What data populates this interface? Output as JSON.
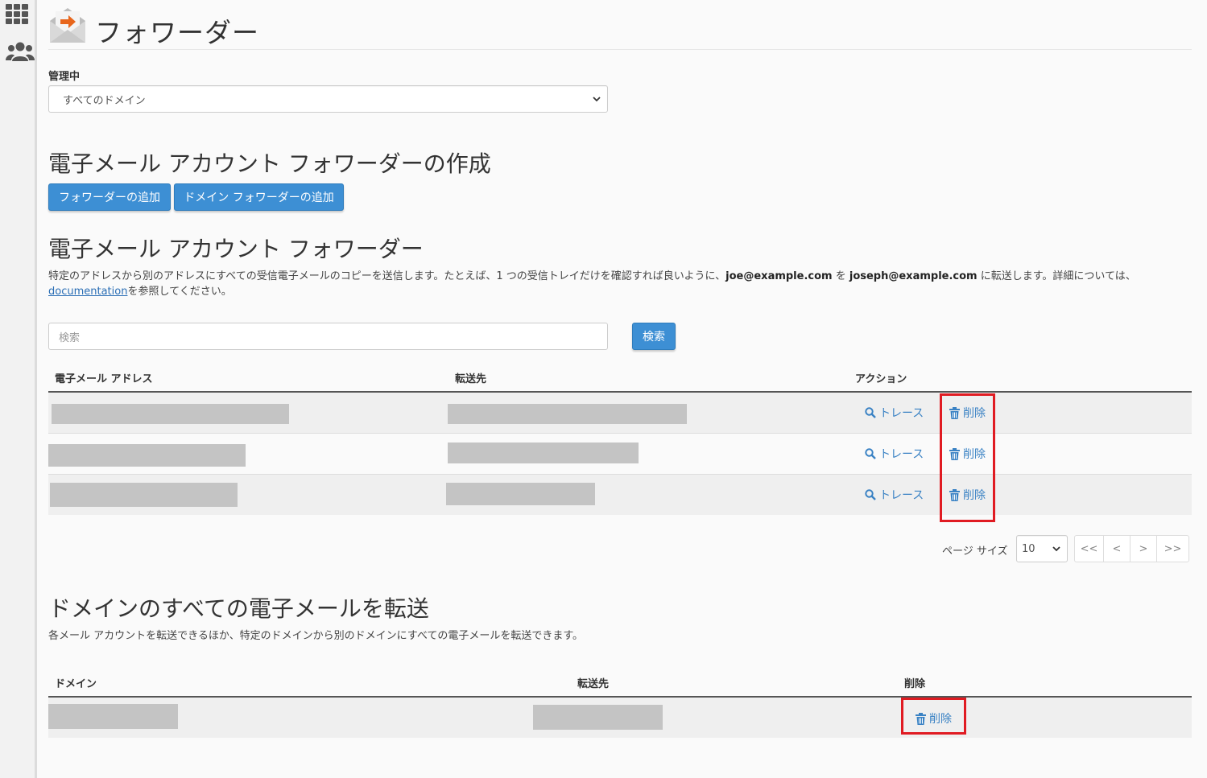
{
  "page": {
    "title": "フォワーダー",
    "managing_label": "管理中",
    "domain_select_value": "すべてのドメイン"
  },
  "create_section": {
    "heading": "電子メール アカウント フォワーダーの作成",
    "add_forwarder_label": "フォワーダーの追加",
    "add_domain_forwarder_label": "ドメイン フォワーダーの追加"
  },
  "forwarders_section": {
    "heading": "電子メール アカウント フォワーダー",
    "description_part1": "特定のアドレスから別のアドレスにすべての受信電子メールのコピーを送信します。たとえば、1 つの受信トレイだけを確認すれば良いように、",
    "example_from": "joe@example.com",
    "description_part2": " を ",
    "example_to": "joseph@example.com",
    "description_part3": " に転送します。詳細については、",
    "doc_link": "documentation",
    "description_part4": "を参照してください。",
    "search_placeholder": "検索",
    "search_button": "検索",
    "columns": {
      "email": "電子メール アドレス",
      "destination": "転送先",
      "actions": "アクション"
    },
    "trace_label": "トレース",
    "delete_label": "削除",
    "rows": [
      {
        "email": "",
        "destination": ""
      },
      {
        "email": "",
        "destination": ""
      },
      {
        "email": "",
        "destination": ""
      }
    ],
    "page_size_label": "ページ サイズ",
    "page_size_value": "10",
    "pager": {
      "first": "<<",
      "prev": "<",
      "next": ">",
      "last": ">>"
    }
  },
  "domain_section": {
    "heading": "ドメインのすべての電子メールを転送",
    "description": "各メール アカウントを転送できるほか、特定のドメインから別のドメインにすべての電子メールを転送できます。",
    "columns": {
      "domain": "ドメイン",
      "destination": "転送先",
      "delete": "削除"
    },
    "delete_label": "削除",
    "rows": [
      {
        "domain": "",
        "destination": ""
      }
    ]
  },
  "colors": {
    "primary_button": "#3d8fd4",
    "link": "#3a82c4",
    "highlight": "#e01b22",
    "icon_orange": "#e8661c"
  }
}
